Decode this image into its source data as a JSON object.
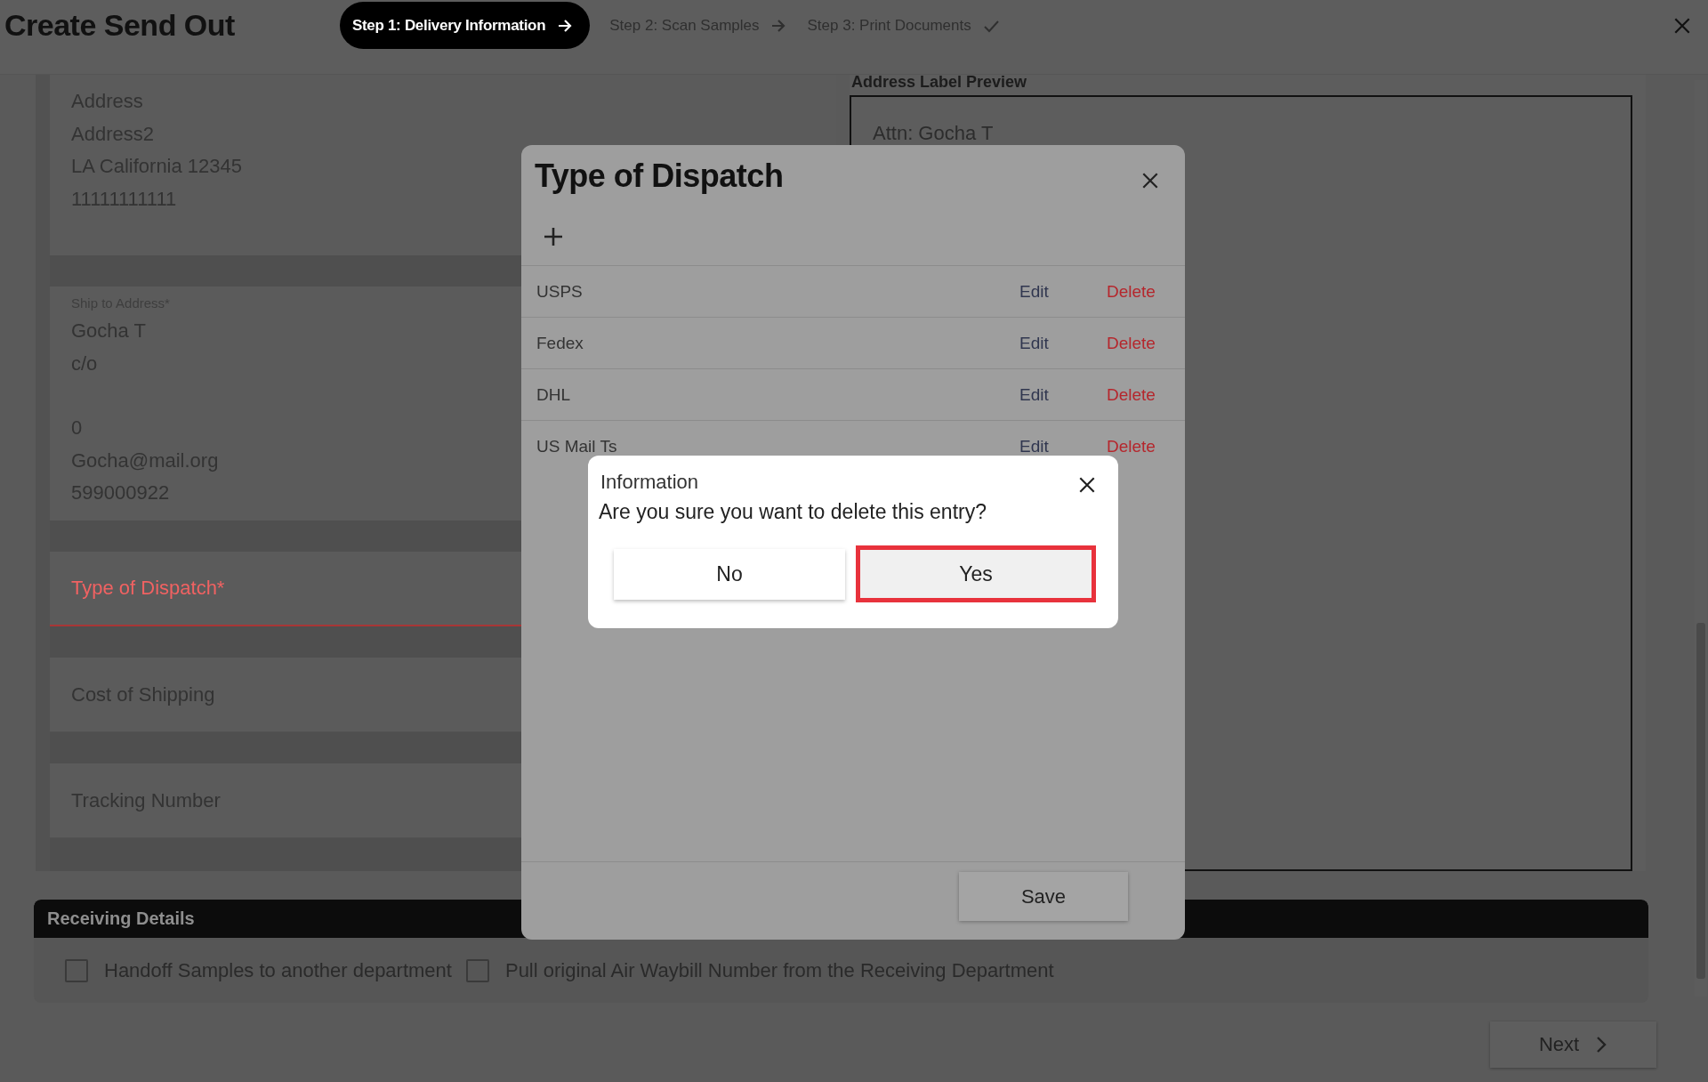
{
  "header": {
    "title": "Create Send Out",
    "steps": [
      {
        "label": "Step 1: Delivery Information",
        "selected": true,
        "kind": "arrow"
      },
      {
        "label": "Step 2: Scan Samples",
        "selected": false,
        "kind": "arrow"
      },
      {
        "label": "Step 3: Print Documents",
        "selected": false,
        "kind": "check"
      }
    ]
  },
  "sender": {
    "lines": [
      "Address",
      "Address2",
      "LA California 12345",
      "11111111111"
    ]
  },
  "ship_to": {
    "label": "Ship to Address*",
    "name_lines": [
      "Gocha T",
      "c/o"
    ],
    "contact_lines": [
      "0",
      "Gocha@mail.org",
      "599000922"
    ]
  },
  "fields": [
    {
      "label": "Type of Dispatch*",
      "error": true
    },
    {
      "label": "Cost of Shipping",
      "error": false
    },
    {
      "label": "Tracking Number",
      "error": false
    }
  ],
  "preview": {
    "title": "Address Label Preview",
    "lines": [
      "Attn: Gocha T"
    ]
  },
  "receiving": {
    "title": "Receiving Details",
    "options": [
      {
        "label": "Handoff Samples to another department",
        "checked": false
      },
      {
        "label": "Pull original Air Waybill Number from the Receiving Department",
        "checked": false
      }
    ]
  },
  "next": {
    "label": "Next"
  },
  "dispatch_dialog": {
    "title": "Type of Dispatch",
    "rows": [
      {
        "name": "USPS",
        "edit": "Edit",
        "delete": "Delete"
      },
      {
        "name": "Fedex",
        "edit": "Edit",
        "delete": "Delete"
      },
      {
        "name": "DHL",
        "edit": "Edit",
        "delete": "Delete"
      },
      {
        "name": "US Mail Ts",
        "edit": "Edit",
        "delete": "Delete"
      }
    ],
    "save": "Save"
  },
  "confirm": {
    "title": "Information",
    "message": "Are you sure you want to delete this entry?",
    "buttons": [
      {
        "label": "No",
        "highlighted": false
      },
      {
        "label": "Yes",
        "highlighted": true
      }
    ]
  }
}
